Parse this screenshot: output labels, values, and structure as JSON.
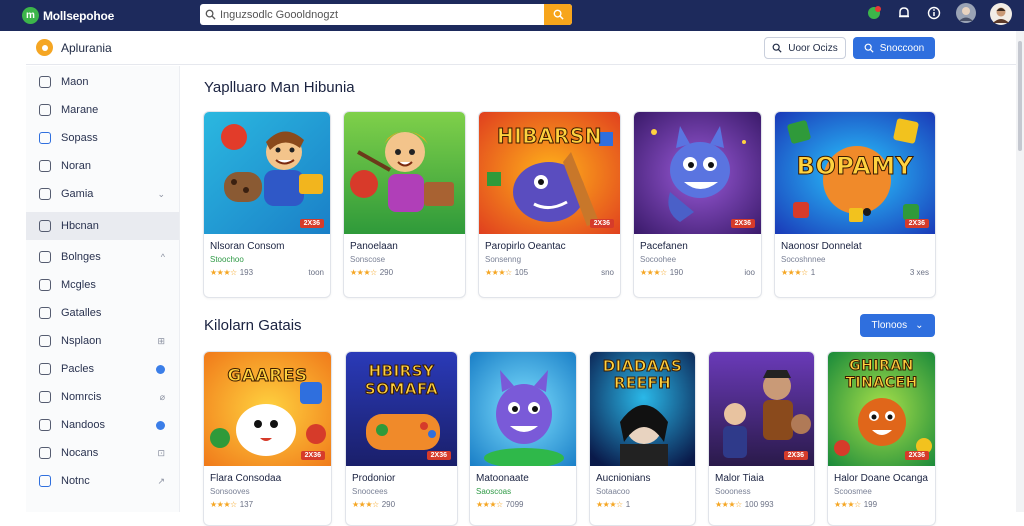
{
  "topbar": {
    "brand": "Mollsepohoe",
    "search_placeholder": "Inguzsodlc Goooldnogzt",
    "icons": [
      "notification-icon",
      "bell-icon",
      "info-icon",
      "avatar",
      "profile-avatar"
    ]
  },
  "header": {
    "app_title": "Aplurania",
    "outline_button": "Uoor Ocizs",
    "primary_button": "Snoccoon"
  },
  "sidebar": {
    "items": [
      {
        "label": "Maon",
        "right": ""
      },
      {
        "label": "Marane",
        "right": ""
      },
      {
        "label": "Sopass",
        "right": ""
      },
      {
        "label": "Noran",
        "right": ""
      },
      {
        "label": "Gamia",
        "right": "⌄"
      },
      {
        "label": "Hbcnan",
        "right": ""
      },
      {
        "label": "Bolnges",
        "right": "^"
      },
      {
        "label": "Mcgles",
        "right": ""
      },
      {
        "label": "Gatalles",
        "right": ""
      },
      {
        "label": "Nsplaon",
        "right": "⊞"
      },
      {
        "label": "Pacles",
        "right": "dot"
      },
      {
        "label": "Nomrcis",
        "right": "⌀"
      },
      {
        "label": "Nandoos",
        "right": "dot"
      },
      {
        "label": "Nocans",
        "right": "⊡"
      },
      {
        "label": "Notnc",
        "right": "↗"
      }
    ]
  },
  "section1": {
    "title": "Yaplluaro Man Hibunia",
    "cards": [
      {
        "title": "Nlsoran Consom",
        "sub": "Stoochoo",
        "rating": "193",
        "meta": "toon",
        "badge": "2X36",
        "banner": ""
      },
      {
        "title": "Panoelaan",
        "sub": "Sonscose",
        "rating": "290",
        "meta": "",
        "badge": "",
        "banner": ""
      },
      {
        "title": "Paropirlo Oeantac",
        "sub": "Sonsenng",
        "rating": "105",
        "meta": "sno",
        "badge": "2X36",
        "banner": "HIBARSN"
      },
      {
        "title": "Pacefanen",
        "sub": "Socoohee",
        "rating": "190",
        "meta": "ioo",
        "badge": "2X36",
        "banner": ""
      },
      {
        "title": "Naonosr Donnelat",
        "sub": "Socoshnnee",
        "rating": "1",
        "meta": "3 xes",
        "badge": "2X36",
        "banner": "BOPAMY"
      }
    ]
  },
  "section2": {
    "title": "Kilolarn Gatais",
    "browse_button": "Tlonoos",
    "cards": [
      {
        "title": "Flara Consodaa",
        "sub": "Sonsooves",
        "rating": "137",
        "meta": "",
        "badge": "2X36",
        "banner": "GAARES"
      },
      {
        "title": "Prodonior",
        "sub": "Snoocees",
        "rating": "290",
        "meta": "",
        "badge": "2X36",
        "banner": "HBIRSY SOMAFA"
      },
      {
        "title": "Matoonaate",
        "sub": "Saoscoas",
        "rating": "7099",
        "meta": "",
        "badge": "",
        "banner": ""
      },
      {
        "title": "Aucnionians",
        "sub": "Sotaacoo",
        "rating": "1",
        "meta": "",
        "badge": "",
        "banner": "DIADAAS REEFH"
      },
      {
        "title": "Malor Tiaia",
        "sub": "Soooness",
        "rating": "100 993",
        "meta": "",
        "badge": "2X36",
        "banner": ""
      },
      {
        "title": "Halor Doane Ocanga",
        "sub": "Scoosmee",
        "rating": "199",
        "meta": "",
        "badge": "2X36",
        "banner": "GHIRAN TINACEH"
      }
    ]
  },
  "colors": {
    "topbar": "#1d2a5c",
    "primary": "#2f6fde",
    "accent": "#f7a51c",
    "star": "#f5a623"
  }
}
